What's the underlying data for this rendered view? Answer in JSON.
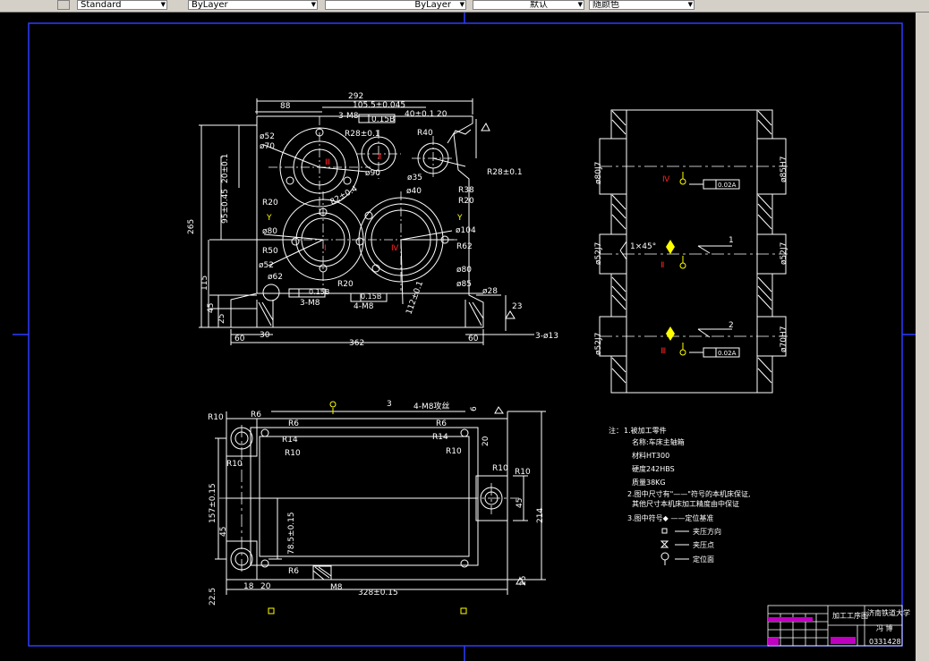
{
  "toolbar": {
    "textstyle": "Standard",
    "layer": "ByLayer",
    "linetype": "ByLayer",
    "lineweight": "默认",
    "plotstyle": "随颜色"
  },
  "views": {
    "front": {
      "dims_top": [
        "292",
        "105.5±0.045",
        "88",
        "3-M8",
        "0.15B",
        "40±0.1",
        "20",
        "R28±0.1",
        "R40"
      ],
      "dims_left": [
        "ø52",
        "ø70",
        "20±0.1",
        "95±0.45",
        "265",
        "115",
        "45",
        "25"
      ],
      "dims_body": [
        "R20",
        "ø80",
        "R50",
        "ø52",
        "ø62",
        "82±0.4",
        "ø90",
        "ø35",
        "ø40",
        "R20",
        "R38",
        "R28±0.1",
        "ø104",
        "R62",
        "ø80",
        "ø85",
        "R20",
        "30",
        "ø28",
        "ø13"
      ],
      "dims_bottom": [
        "60",
        "30",
        "362",
        "60",
        "3-ø13"
      ],
      "notes": [
        "0.15B",
        "3-M8",
        "0.15B",
        "4-M8",
        "112±0.1",
        "23"
      ],
      "roman": [
        "Ⅲ",
        "I",
        "Ⅱ",
        "Ⅳ",
        "Y",
        "Y"
      ]
    },
    "side": {
      "dims_left": [
        "ø80J7",
        "ø52J7",
        "ø52J7"
      ],
      "dims_right": [
        "ø85H7",
        "ø52J7",
        "ø70H7"
      ],
      "notes": [
        "1×45°",
        "1",
        "2",
        "0.02A",
        "0.02A"
      ],
      "roman": [
        "Ⅳ",
        "Ⅱ",
        "Ⅲ"
      ]
    },
    "top": {
      "labels": [
        "3",
        "4-M8攻丝",
        "6",
        "R10",
        "R6",
        "R6",
        "R6",
        "R14",
        "R10",
        "R14",
        "R10",
        "R10",
        "R10",
        "R10",
        "R6",
        "157±0.15",
        "45",
        "78.5±0.15",
        "45",
        "214",
        "20",
        "18",
        "20",
        "M8",
        "328±0.15",
        "22.5",
        "25"
      ]
    }
  },
  "notes": {
    "title": "注：",
    "lines": [
      "1.被加工零件",
      "名称:车床主轴箱",
      "材料HT300",
      "硬度242HBS",
      "质量38KG",
      "2.图中尺寸有\"——\"符号的本机床保证,",
      "其他尺寸本机床加工精度由中保证",
      "3.图中符号◆ ——定位基准"
    ],
    "legend": [
      "夹压方向",
      "夹压点",
      "定位面"
    ]
  },
  "title_block": {
    "drawing_type": "加工工序图",
    "school": "济南铁道大学",
    "designer": "冯 博",
    "number": "0331428"
  }
}
